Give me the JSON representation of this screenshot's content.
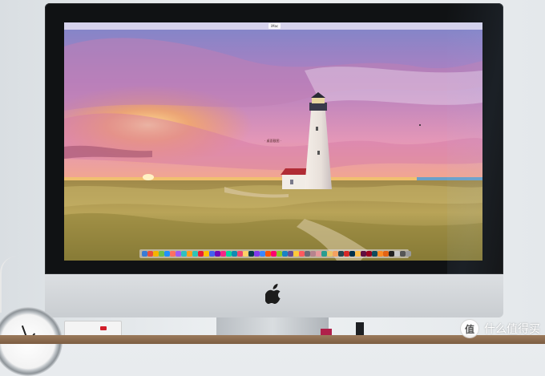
{
  "screen": {
    "menubar_title": "iMac",
    "desktop_label": "· 桌面截图 ·"
  },
  "dock": {
    "icon_colors": [
      "#3a7bd5",
      "#e94e3d",
      "#f5b400",
      "#6cc04a",
      "#1e90ff",
      "#ff6f61",
      "#a05cf2",
      "#30c0c0",
      "#ff9f1c",
      "#2ec4b6",
      "#e71d36",
      "#ffbf00",
      "#4361ee",
      "#7209b7",
      "#f72585",
      "#06d6a0",
      "#118ab2",
      "#ef476f",
      "#ffd166",
      "#073b4c",
      "#8338ec",
      "#3a86ff",
      "#fb5607",
      "#ff006e",
      "#8ac926",
      "#1982c4",
      "#6a4c93",
      "#ffca3a",
      "#ff595e",
      "#6d6875",
      "#b5838d",
      "#e5989b",
      "#2a9d8f",
      "#e9c46a",
      "#f4a261",
      "#264653",
      "#d62828",
      "#003049",
      "#fcbf49",
      "#5f0f40",
      "#9a031e",
      "#0f4c5c",
      "#fb8b24",
      "#e36414",
      "#222222",
      "#c9c9c9",
      "#555555",
      "#999999"
    ]
  },
  "watermark": {
    "logo_char": "值",
    "text": "什么值得买"
  },
  "colors": {
    "bezel": "#101214",
    "chin": "#d0d4d8",
    "sunset_orange": "#f08a3c",
    "sky_purple": "#8b6fb8"
  }
}
